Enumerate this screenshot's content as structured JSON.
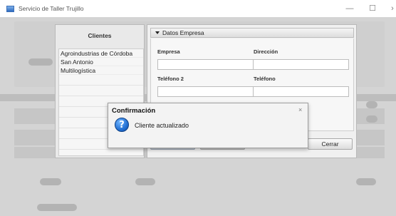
{
  "window": {
    "title": "Servicio de Taller Trujillo",
    "minimize_glyph": "—",
    "maximize_glyph": "☐",
    "close_glyph": "›"
  },
  "clients": {
    "header": "Clientes",
    "items": [
      "Agroindustrias de Córdoba",
      "San Antonio",
      "Multilogística"
    ]
  },
  "empresa": {
    "tab_label": "Datos Empresa",
    "fields": {
      "empresa": {
        "label": "Empresa",
        "value": ""
      },
      "direccion": {
        "label": "Dirección",
        "value": ""
      },
      "telefono2": {
        "label": "Teléfono 2",
        "value": ""
      },
      "telefono": {
        "label": "Teléfono",
        "value": ""
      }
    },
    "buttons": {
      "primary_label": "",
      "secondary_label": "",
      "close_label": "Cerrar"
    }
  },
  "dialog": {
    "title": "Confirmación",
    "close_glyph": "×",
    "message": "Cliente actualizado",
    "icon": "question-icon",
    "icon_glyph": "?"
  },
  "colors": {
    "dim_overlay": "#d4d4d4",
    "icon_blue": "#1f6cd0"
  }
}
